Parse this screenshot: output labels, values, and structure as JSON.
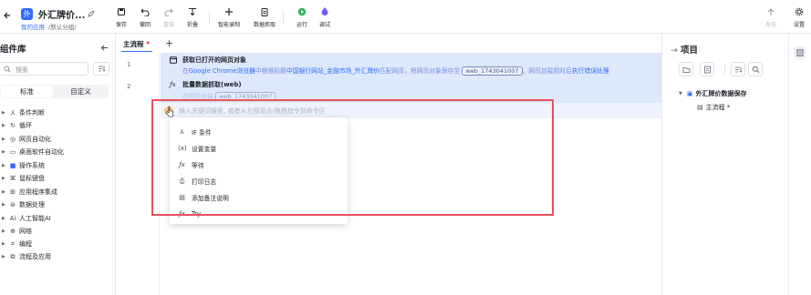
{
  "header": {
    "app_logo": "外",
    "title": "外汇牌价...",
    "crumb_app": "我的应用",
    "crumb_path": "/默认分组/",
    "toolbar": [
      {
        "label": "保存",
        "icon": "save-icon",
        "enabled": true
      },
      {
        "label": "撤回",
        "icon": "undo-icon",
        "enabled": true
      },
      {
        "label": "重做",
        "icon": "redo-icon",
        "enabled": false
      },
      {
        "label": "折叠",
        "icon": "fold-icon",
        "enabled": true
      },
      {
        "label": "智能录制",
        "icon": "plus-icon",
        "enabled": true
      },
      {
        "label": "数据抓取",
        "icon": "clipboard-icon",
        "enabled": true
      },
      {
        "label": "运行",
        "icon": "run-icon",
        "enabled": true
      },
      {
        "label": "调试",
        "icon": "debug-icon",
        "enabled": true
      },
      {
        "label": "发布",
        "icon": "publish-icon",
        "enabled": false
      },
      {
        "label": "设置",
        "icon": "gear-icon",
        "enabled": true
      }
    ]
  },
  "left_panel": {
    "title": "组件库",
    "search_placeholder": "搜索",
    "tabs": [
      "标准",
      "自定义"
    ],
    "active_tab": "标准",
    "categories": [
      {
        "label": "条件判断",
        "icon": "branch-icon"
      },
      {
        "label": "循环",
        "icon": "loop-icon"
      },
      {
        "label": "网页自动化",
        "icon": "globe-icon"
      },
      {
        "label": "桌面软件自动化",
        "icon": "monitor-icon"
      },
      {
        "label": "操作系统",
        "icon": "os-icon"
      },
      {
        "label": "鼠标键盘",
        "icon": "mouse-icon"
      },
      {
        "label": "应用程序集成",
        "icon": "app-icon"
      },
      {
        "label": "数据处理",
        "icon": "data-icon"
      },
      {
        "label": "人工智能AI",
        "icon": "ai-icon"
      },
      {
        "label": "网络",
        "icon": "network-icon"
      },
      {
        "label": "编程",
        "icon": "code-icon"
      },
      {
        "label": "流程及应用",
        "icon": "flow-icon"
      }
    ]
  },
  "main": {
    "flow_tab": "主流程",
    "flow_tab_modified": "*",
    "add_tab": "+",
    "line_numbers": [
      "1",
      "2"
    ],
    "step1": {
      "title": "获取已打开的网页对象",
      "desc_a": "在",
      "desc_b": "Google Chrome浏览器",
      "desc_c": "中根据标题",
      "desc_d": "中国银行网站_金融市场_外汇牌价",
      "desc_e": "匹配网页，将网页对象保存至",
      "var": "web_1743041007",
      "desc_f": "，网页加载超时后",
      "desc_g": "执行错误处理"
    },
    "step2": {
      "title": "批量数据抓取(web)",
      "desc_a": "在网页对象",
      "var": "web_1743041007"
    },
    "insert_placeholder": "输入关键词搜索, 或者从左侧双击/拖拽指令到命令区",
    "menu_items": [
      {
        "label": "IF 条件",
        "icon": "branch-icon"
      },
      {
        "label": "设置变量",
        "icon": "variable-icon"
      },
      {
        "label": "等待",
        "icon": "fx-icon"
      },
      {
        "label": "打印日志",
        "icon": "print-icon"
      },
      {
        "label": "添加备注说明",
        "icon": "note-icon"
      },
      {
        "label": "Try",
        "icon": "fx-icon"
      }
    ]
  },
  "right_panel": {
    "title": "项目",
    "tree_root": "外汇牌价数据保存",
    "tree_child": "主流程",
    "tree_child_modified": "*"
  },
  "colors": {
    "accent": "#2f6bff",
    "step_bg": "#dde8fb",
    "highlight": "#e8505b",
    "run_green": "#2fb35a",
    "debug_purple": "#7b5cff"
  }
}
